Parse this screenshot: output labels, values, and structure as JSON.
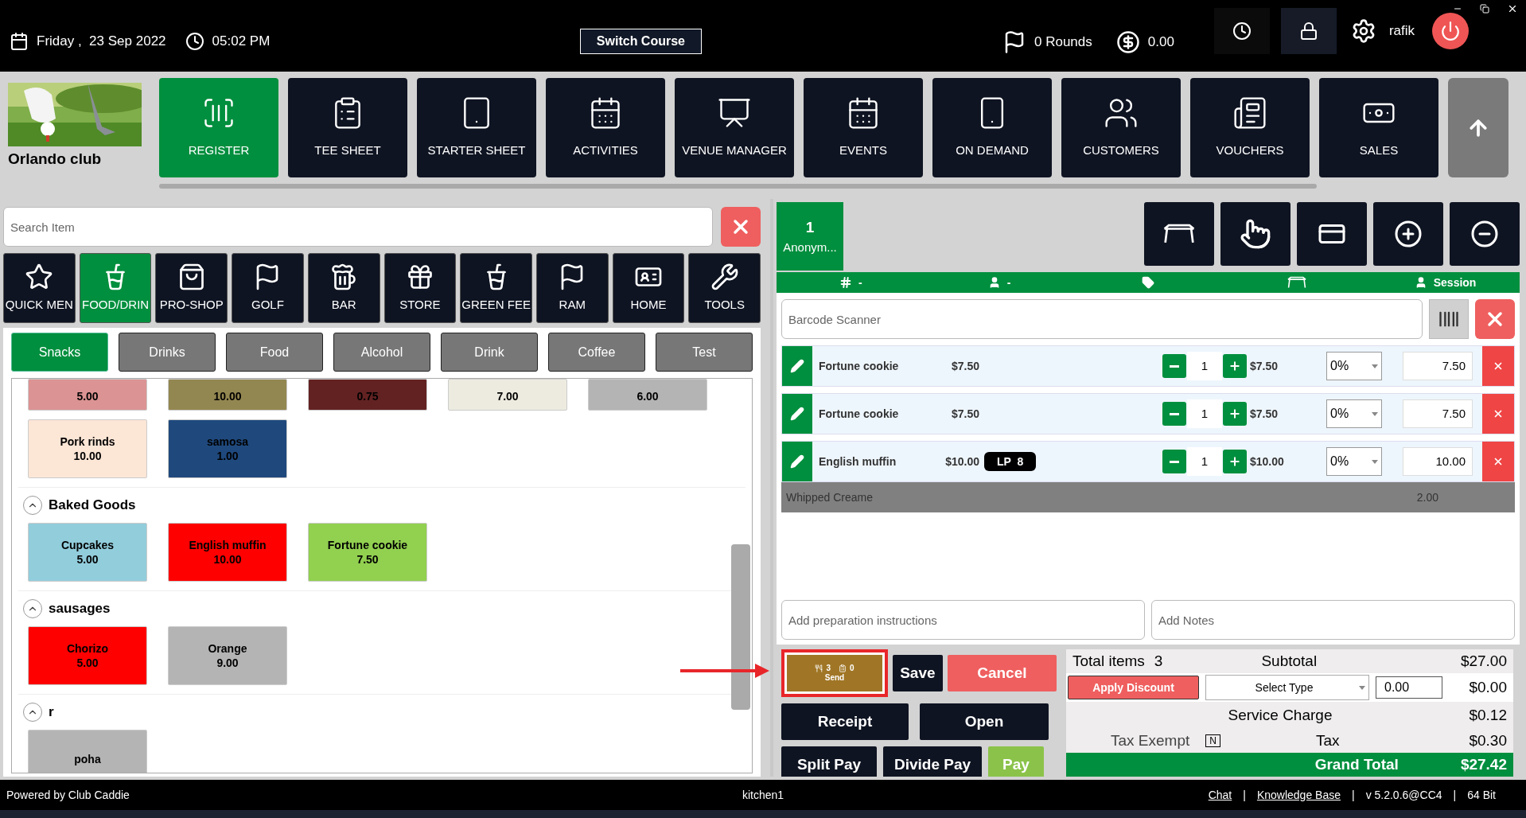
{
  "header": {
    "date": "Friday ,  23 Sep 2022",
    "time": "05:02 PM",
    "switch_course": "Switch Course",
    "rounds": "0 Rounds",
    "balance": "0.00",
    "user": "rafik"
  },
  "club": {
    "name": "Orlando club"
  },
  "nav": [
    {
      "label": "REGISTER",
      "selected": true
    },
    {
      "label": "TEE SHEET",
      "selected": false
    },
    {
      "label": "STARTER SHEET",
      "selected": false
    },
    {
      "label": "ACTIVITIES",
      "selected": false
    },
    {
      "label": "VENUE MANAGER",
      "selected": false
    },
    {
      "label": "EVENTS",
      "selected": false
    },
    {
      "label": "ON DEMAND",
      "selected": false
    },
    {
      "label": "CUSTOMERS",
      "selected": false
    },
    {
      "label": "VOUCHERS",
      "selected": false
    },
    {
      "label": "SALES",
      "selected": false
    }
  ],
  "search": {
    "placeholder": "Search Item"
  },
  "categories": [
    {
      "label": "QUICK MEN",
      "selected": false
    },
    {
      "label": "FOOD/DRIN",
      "selected": true
    },
    {
      "label": "PRO-SHOP",
      "selected": false
    },
    {
      "label": "GOLF",
      "selected": false
    },
    {
      "label": "BAR",
      "selected": false
    },
    {
      "label": "STORE",
      "selected": false
    },
    {
      "label": "GREEN FEE",
      "selected": false
    },
    {
      "label": "RAM",
      "selected": false
    },
    {
      "label": "HOME",
      "selected": false
    },
    {
      "label": "TOOLS",
      "selected": false
    }
  ],
  "subcategories": [
    {
      "label": "Snacks",
      "selected": true
    },
    {
      "label": "Drinks",
      "selected": false
    },
    {
      "label": "Food",
      "selected": false
    },
    {
      "label": "Alcohol",
      "selected": false
    },
    {
      "label": "Drink",
      "selected": false
    },
    {
      "label": "Coffee",
      "selected": false
    },
    {
      "label": "Test",
      "selected": false
    }
  ],
  "item_groups": [
    {
      "items": [
        {
          "price": "5.00",
          "color": "#dc9393"
        },
        {
          "price": "10.00",
          "color": "#938751"
        },
        {
          "price": "0.75",
          "color": "#632222"
        },
        {
          "price": "7.00",
          "color": "#edebe0"
        },
        {
          "price": "6.00",
          "color": "#b4b4b4"
        },
        {
          "name": "Pork rinds",
          "price": "10.00",
          "color": "#fce6d6"
        },
        {
          "name": "samosa",
          "price": "1.00",
          "color": "#1f497d"
        }
      ]
    },
    {
      "title": "Baked Goods",
      "expanded": true,
      "items": [
        {
          "name": "Cupcakes",
          "price": "5.00",
          "color": "#92cddc"
        },
        {
          "name": "English muffin",
          "price": "10.00",
          "color": "#ff0000"
        },
        {
          "name": "Fortune cookie",
          "price": "7.50",
          "color": "#92d050"
        }
      ]
    },
    {
      "title": "sausages",
      "expanded": true,
      "items": [
        {
          "name": "Chorizo",
          "price": "5.00",
          "color": "#ff0000"
        },
        {
          "name": "Orange",
          "price": "9.00",
          "color": "#b4b4b4"
        }
      ]
    },
    {
      "title": "r",
      "expanded": true,
      "items": [
        {
          "name": "poha",
          "color": "#b4b4b4"
        }
      ]
    }
  ],
  "order": {
    "tab": {
      "number": "1",
      "name": "Anonym...",
      "selected": true
    },
    "info_bar": [
      {
        "kind": "number",
        "text": "-"
      },
      {
        "kind": "guest",
        "text": "-"
      },
      {
        "kind": "tag"
      },
      {
        "kind": "table"
      },
      {
        "kind": "server",
        "text": "Session"
      }
    ],
    "barcode": {
      "placeholder": "Barcode Scanner"
    },
    "lines": [
      {
        "name": "Fortune cookie",
        "unit_price": "$7.50",
        "qty": "1",
        "total": "$7.50",
        "discount": "0%",
        "amount": "7.50"
      },
      {
        "name": "Fortune cookie",
        "unit_price": "$7.50",
        "qty": "1",
        "total": "$7.50",
        "discount": "0%",
        "amount": "7.50"
      },
      {
        "name": "English muffin",
        "unit_price": "$10.00",
        "badge": "LP  8",
        "qty": "1",
        "total": "$10.00",
        "discount": "0%",
        "amount": "10.00"
      }
    ],
    "modifiers": [
      {
        "name": "Whipped Creame",
        "amount": "2.00"
      }
    ],
    "prep": {
      "placeholder": "Add preparation instructions"
    },
    "notes": {
      "placeholder": "Add Notes"
    }
  },
  "actions": {
    "send": {
      "items": "3",
      "tickets": "0",
      "label": "Send",
      "highlighted": true
    },
    "save": "Save",
    "cancel": "Cancel",
    "receipt": "Receipt",
    "open": "Open",
    "split_pay": "Split Pay",
    "divide_pay": "Divide Pay",
    "pay": "Pay"
  },
  "totals": {
    "total_items_label": "Total items",
    "total_items": "3",
    "subtotal_label": "Subtotal",
    "subtotal": "$27.00",
    "apply_discount": "Apply Discount",
    "discount_type": "Select Type",
    "discount_value": "0.00",
    "discount": "$0.00",
    "service_charge_label": "Service Charge",
    "service_charge": "$0.12",
    "tax_exempt_label": "Tax Exempt",
    "tax_exempt": "N",
    "tax_label": "Tax",
    "tax": "$0.30",
    "grand_total_label": "Grand Total",
    "grand_total": "$27.42"
  },
  "footer": {
    "powered": "Powered by Club Caddie",
    "station": "kitchen1",
    "separator": "|",
    "items": [
      {
        "kind": "link",
        "text": "Chat"
      },
      {
        "kind": "link",
        "text": "Knowledge Base"
      },
      {
        "kind": "text",
        "text": "v 5.2.0.6@CC4"
      },
      {
        "kind": "text",
        "text": "64 Bit"
      }
    ]
  }
}
